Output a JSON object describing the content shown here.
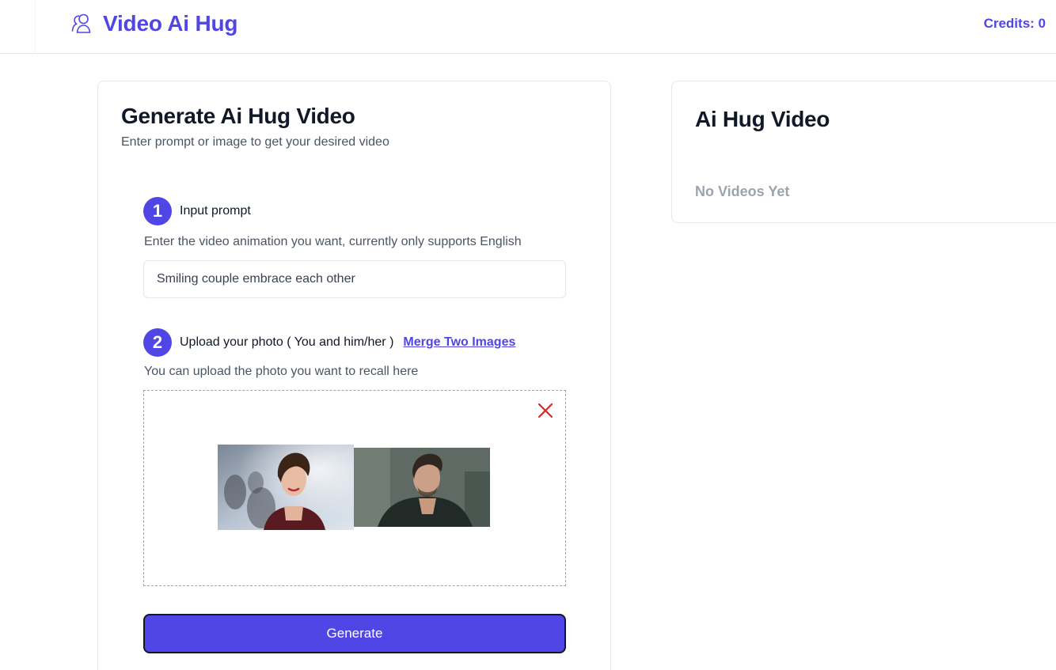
{
  "header": {
    "brand": "Video Ai Hug",
    "brand_icon": "users-icon",
    "credits": "Credits: 0"
  },
  "generator": {
    "title": "Generate Ai Hug Video",
    "subtitle": "Enter prompt or image to get your desired video",
    "step1": {
      "number": "1",
      "label": "Input prompt",
      "hint": "Enter the video animation you want, currently only supports English",
      "value": "Smiling couple embrace each other"
    },
    "step2": {
      "number": "2",
      "label": "Upload your photo ( You and him/her )",
      "link": "Merge Two Images",
      "hint": "You can upload the photo you want to recall here"
    },
    "generate_label": "Generate"
  },
  "results": {
    "title": "Ai Hug Video",
    "empty": "No Videos Yet"
  },
  "colors": {
    "accent": "#4f46e5",
    "remove": "#dc2626"
  }
}
